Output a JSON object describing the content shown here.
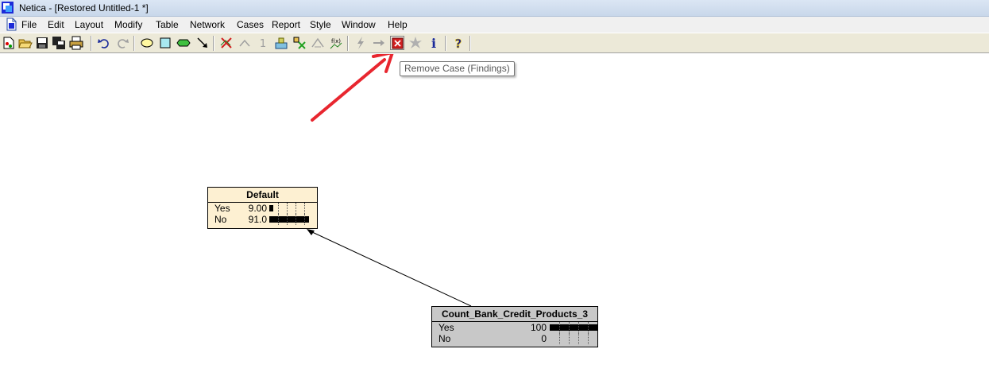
{
  "window": {
    "title": "Netica - [Restored Untitled-1 *]"
  },
  "menu": [
    "File",
    "Edit",
    "Layout",
    "Modify",
    "Table",
    "Network",
    "Cases",
    "Report",
    "Style",
    "Window",
    "Help"
  ],
  "toolbar": {
    "tooltip": "Remove Case (Findings)",
    "info_glyph": "i",
    "help_glyph": "?",
    "one_glyph": "1",
    "fx_glyph": "f(x)"
  },
  "colors": {
    "node_default_bg": "#fdf0d2",
    "node_count_bg": "#c8c8c8",
    "annotation_arrow": "#e8262f"
  },
  "nodes": {
    "default": {
      "title": "Default",
      "states": [
        {
          "name": "Yes",
          "value": "9.00",
          "belief": 9.0
        },
        {
          "name": "No",
          "value": "91.0",
          "belief": 91.0
        }
      ]
    },
    "count": {
      "title": "Count_Bank_Credit_Products_3",
      "states": [
        {
          "name": "Yes",
          "value": "100",
          "belief": 100
        },
        {
          "name": "No",
          "value": "0",
          "belief": 0
        }
      ]
    }
  }
}
